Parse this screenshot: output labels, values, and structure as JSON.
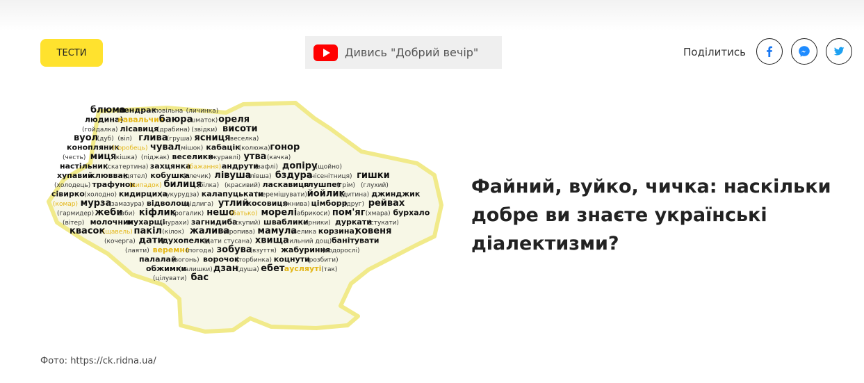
{
  "tag_button": {
    "label": "ТЕСТИ"
  },
  "watch": {
    "label": "Дивись \"Добрий вечір\""
  },
  "share": {
    "label": "Поділитись"
  },
  "article": {
    "title": "Файний, вуйко, чичка: наскільки добре ви знаєте українські діалектизми?"
  },
  "caption": {
    "prefix": "Фото: ",
    "link": "https://ck.ridna.ua/"
  },
  "map_words": [
    "блюма",
    "пендрак",
    "(повільна",
    "(личинка)",
    "людина)",
    "кавальчик",
    "баюра",
    "(шматок)",
    "ореля",
    "(гойдалка)",
    "лісавиця",
    "(драбина)",
    "(звідки)",
    "висоти",
    "вуол",
    "(дуб)",
    "(віл)",
    "глива",
    "(груша)",
    "ясниця",
    "(веселка)",
    "конопляник",
    "(горобець)",
    "чувал",
    "(мішок)",
    "кабацік",
    "(колюжа)",
    "гонор",
    "(честь)",
    "миця",
    "(кішка)",
    "(піджак)",
    "веселики",
    "(журавлі)",
    "утва",
    "(качка)",
    "настільник",
    "(скатертина)",
    "захцянка",
    "(бажання)",
    "андрути",
    "(вафлі)",
    "допіру",
    "(щойно)",
    "хупавий",
    "клюввак",
    "(дятел)",
    "кобушка",
    "(глечик)",
    "лівуша",
    "(лівша)",
    "бздура",
    "(нісенітниця)",
    "гишки",
    "(холодець)",
    "трафунок",
    "(випадок)",
    "билиця",
    "(білка)",
    "(красивий)",
    "ласкавиця",
    "глушпет",
    "(грім)",
    "(глухий)",
    "сівирко",
    "(холодно)",
    "кидирциха",
    "(кукурудза)",
    "калапуцькати",
    "(перемішувати)",
    "йойлик",
    "(дитина)",
    "джинджик",
    "(комар)",
    "мурза",
    "(замазура)",
    "відволощ",
    "(відлига)",
    "утлий",
    "косовиця",
    "(жнива)",
    "цімборр",
    "(друг)",
    "рейвах",
    "(гармидер)",
    "жеби",
    "(аби)",
    "кіфлик",
    "(рогалик)",
    "нешо",
    "(батько)",
    "морелі",
    "(абрикоси)",
    "пом'яг",
    "(хмара)",
    "бурхало",
    "(вітер)",
    "молочник",
    "мухарщі",
    "(мурахи)",
    "загнидиба",
    "(скупий)",
    "шваблики",
    "(сірники)",
    "дуркати",
    "(стукати)",
    "квасок",
    "(щавель)",
    "пакіл",
    "(кілок)",
    "жалива",
    "(кропива)",
    "мамула",
    "(велика",
    "корзина)",
    "ковеня",
    "(кочерга)",
    "дати",
    "духопелки",
    "(дати стусана)",
    "хвища",
    "(сильний дощ)",
    "банітувати",
    "(лаяти)",
    "веремнє",
    "(погода)",
    "зобува",
    "(взуття)",
    "жабуриння",
    "(водорослі)",
    "палалай",
    "(вогонь)",
    "ворочок",
    "(торбинка)",
    "коцнути",
    "(розбити)",
    "обжимки",
    "(залишки)",
    "дзан",
    "(душа)",
    "ебет",
    "аусляуті",
    "(так)",
    "(цілувати)",
    "бас"
  ]
}
